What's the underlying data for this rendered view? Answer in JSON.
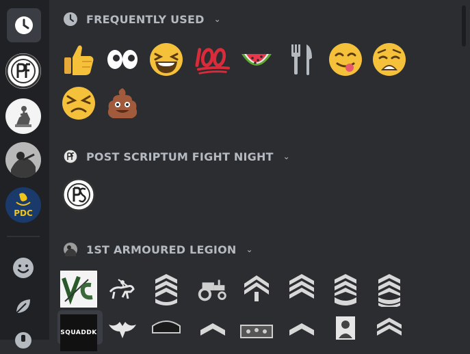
{
  "sections": [
    {
      "title": "FREQUENTLY USED"
    },
    {
      "title": "POST SCRIPTUM FIGHT NIGHT"
    },
    {
      "title": "1ST ARMOURED LEGION"
    }
  ],
  "servers": [
    {
      "name": "recent",
      "text": ""
    },
    {
      "name": "server-pfn",
      "text": ""
    },
    {
      "name": "server-statue",
      "text": ""
    },
    {
      "name": "server-soldier",
      "text": ""
    },
    {
      "name": "server-pdc",
      "text": "PDC"
    }
  ],
  "legion_emoji_texts": {
    "vs": "V5",
    "squad": "SQUADDK"
  },
  "colors": {
    "bg": "#2b2d31",
    "sidebar": "#1f2124",
    "header_text": "#b5bac1",
    "pdc_blue": "#1a3a6b",
    "pdc_yellow": "#f0c419"
  }
}
